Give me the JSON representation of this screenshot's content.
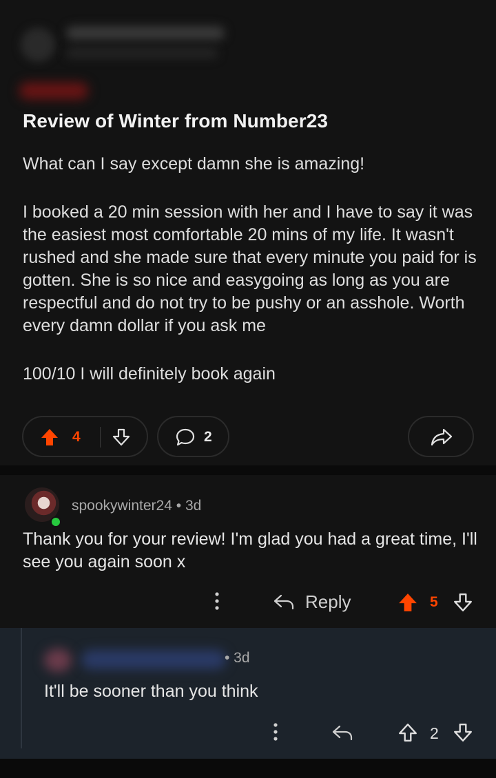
{
  "post": {
    "title": "Review of Winter from Number23",
    "paragraphs": [
      "What can I say except damn she is amazing!",
      "I booked a 20 min session with her and I have to say it was the easiest most comfortable 20 mins of my life. It wasn't rushed and she made sure that every minute you paid for is gotten. She is so nice and easygoing as long as you are respectful and do not try to be pushy or an asshole. Worth every damn dollar if you ask me",
      "100/10 I will definitely book again"
    ],
    "upvotes": "4",
    "comments": "2",
    "upvote_color": "#ff4500"
  },
  "comment1": {
    "username": "spookywinter24",
    "age": "• 3d",
    "text": "Thank you for your review! I'm glad you had a great time, I'll see you again soon x",
    "reply_label": "Reply",
    "votes": "5"
  },
  "comment2": {
    "age": "• 3d",
    "text": "It'll be sooner than you think",
    "votes": "2"
  }
}
